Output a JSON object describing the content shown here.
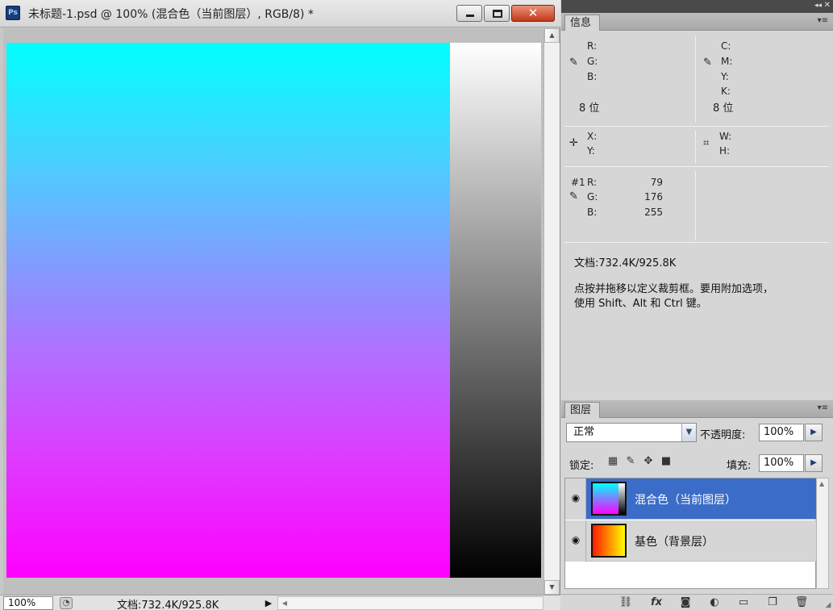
{
  "document": {
    "app_icon": "Ps",
    "title": "未标题-1.psd @ 100% (混合色（当前图层）, RGB/8) *",
    "close_glyph": "✕",
    "status": {
      "zoom": "100%",
      "doc_size": "文档:732.4K/925.8K",
      "arrow": "▶"
    },
    "scroll_up": "▲",
    "scroll_down": "▼",
    "scroll_left": "◀"
  },
  "dock": {
    "collapse": "◂◂",
    "close": "✕"
  },
  "info_panel": {
    "tab": "信息",
    "menu": "▾≡",
    "rgb": {
      "r_label": "R:",
      "g_label": "G:",
      "b_label": "B:",
      "bits": "8 位"
    },
    "cmyk": {
      "c_label": "C:",
      "m_label": "M:",
      "y_label": "Y:",
      "k_label": "K:",
      "bits": "8 位"
    },
    "pos": {
      "x_label": "X:",
      "y_label": "Y:"
    },
    "size": {
      "w_label": "W:",
      "h_label": "H:"
    },
    "sampler": {
      "prefix": "#1",
      "r_label": "R:",
      "g_label": "G:",
      "b_label": "B:",
      "r": "79",
      "g": "176",
      "b": "255"
    },
    "doc_size": "文档:732.4K/925.8K",
    "hint_line1": "点按并拖移以定义裁剪框。要用附加选项，",
    "hint_line2": "使用 Shift、Alt 和 Ctrl 键。"
  },
  "layers_panel": {
    "tab": "图层",
    "menu": "▾≡",
    "blend_mode": "正常",
    "opacity_label": "不透明度:",
    "opacity": "100%",
    "lock_label": "锁定:",
    "fill_label": "填充:",
    "fill": "100%",
    "layers": [
      {
        "name": "混合色（当前图层）",
        "selected": true
      },
      {
        "name": "基色（背景层）",
        "selected": false
      }
    ],
    "footer_icons": [
      "link-icon",
      "fx-icon",
      "mask-icon",
      "adjustment-icon",
      "group-icon",
      "new-layer-icon",
      "trash-icon"
    ],
    "footer_glyphs": [
      "⛓",
      "fx",
      "◙",
      "◐",
      "▭",
      "❐",
      "🗑"
    ]
  }
}
